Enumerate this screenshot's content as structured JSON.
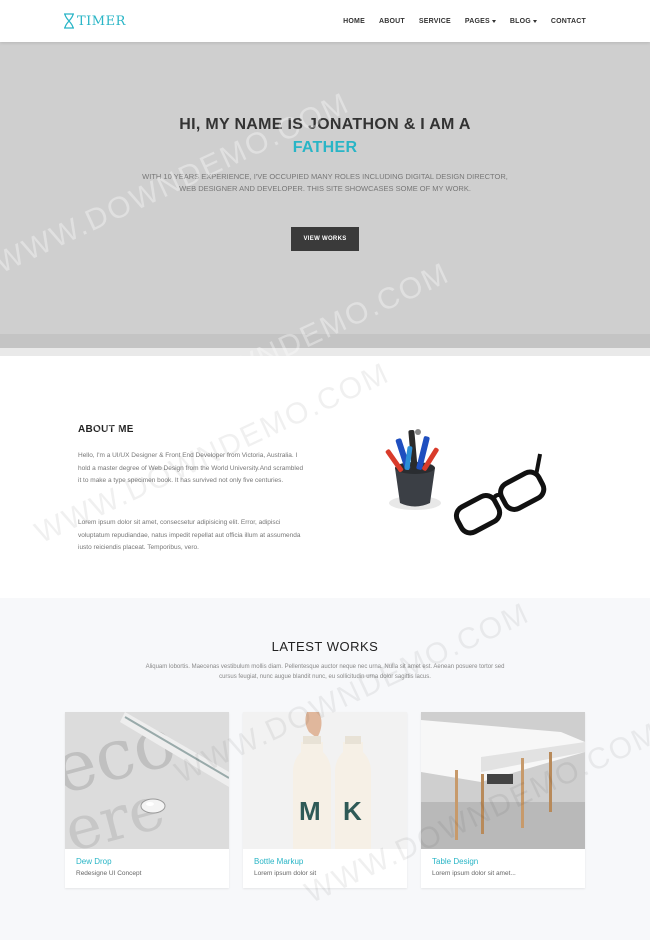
{
  "nav": {
    "logo_text": "TIMER",
    "items": [
      {
        "label": "HOME",
        "dropdown": false
      },
      {
        "label": "ABOUT",
        "dropdown": false
      },
      {
        "label": "SERVICE",
        "dropdown": false
      },
      {
        "label": "PAGES",
        "dropdown": true
      },
      {
        "label": "BLOG",
        "dropdown": true
      },
      {
        "label": "CONTACT",
        "dropdown": false
      }
    ]
  },
  "hero": {
    "title": "HI, MY NAME IS JONATHON & I AM A",
    "highlight": "FATHER",
    "description": "WITH 10 YEARS EXPERIENCE, I'VE OCCUPIED MANY ROLES INCLUDING DIGITAL DESIGN DIRECTOR, WEB DESIGNER AND DEVELOPER. THIS SITE SHOWCASES SOME OF MY WORK.",
    "button_label": "VIEW WORKS"
  },
  "about": {
    "title": "ABOUT ME",
    "paragraph1": "Hello, I'm a UI/UX Designer & Front End Developer from Victoria, Australia. I hold a master degree of Web Design from the World University.And scrambled it to make a type specimen book. It has survived not only five centuries.",
    "paragraph2": "Lorem ipsum dolor sit amet, consecsetur adipisicing elit. Error, adipisci voluptatum repudiandae, natus impedit repellat aut officia illum at assumenda iusto reiciendis placeat. Temporibus, vero."
  },
  "works": {
    "title": "LATEST WORKS",
    "description": "Aliquam lobortis. Maecenas vestibulum mollis diam. Pellentesque auctor neque nec urna. Nulla sit amet est. Aenean posuere tortor sed cursus feugiat, nunc augue blandit nunc, eu sollicitudin urna dolor sagittis lacus.",
    "cards": [
      {
        "title": "Dew Drop",
        "subtitle": "Redesigne UI Concept"
      },
      {
        "title": "Bottle Markup",
        "subtitle": "Lorem ipsum dolor sit"
      },
      {
        "title": "Table Design",
        "subtitle": "Lorem ipsum dolor sit amet..."
      }
    ]
  },
  "watermark": "WWW.DOWNDEMO.COM",
  "colors": {
    "accent": "#29b5c6",
    "hero_bg": "#cfcfcf",
    "button_bg": "#3a3a3a"
  }
}
